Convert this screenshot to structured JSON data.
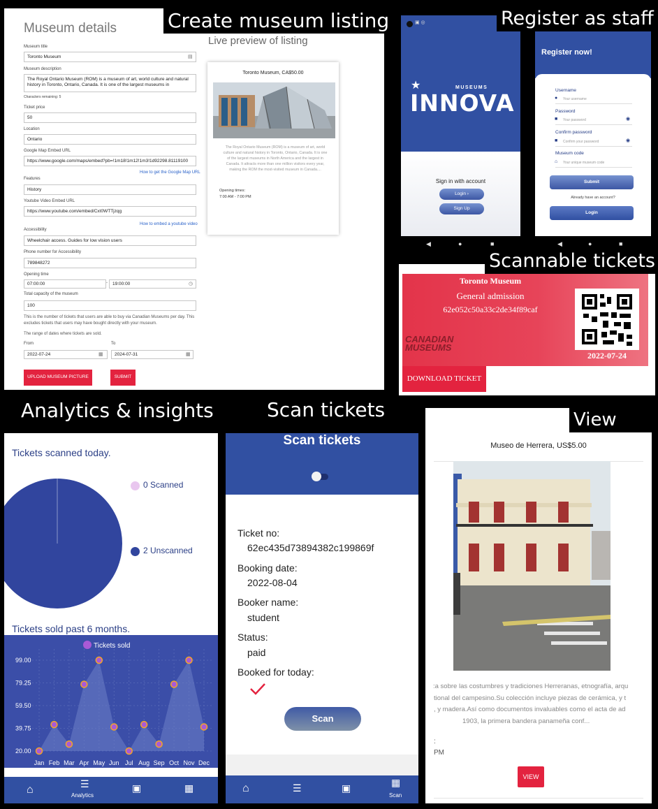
{
  "captions": {
    "create": "Create museum listing",
    "register": "Register as staff",
    "scannable": "Scannable tickets",
    "analytics": "Analytics & insights",
    "scan": "Scan tickets",
    "view": "View"
  },
  "form": {
    "title": "Museum details",
    "museum_title_label": "Museum title",
    "museum_title_value": "Toronto Museum",
    "description_label": "Museum description",
    "description_value": "The Royal Ontario Museum (ROM) is a museum of art, world culture and natural history in Toronto, Ontario, Canada. It is one of the largest museums in",
    "chars_remaining": "Characters remaining: 5",
    "ticket_price_label": "Ticket price",
    "ticket_price_value": "50",
    "location_label": "Location",
    "location_value": "Ontario",
    "map_label": "Google Map Embed URL",
    "map_value": "https://www.google.com/maps/embed?pb=!1m18!1m12!1m3!1d92298.81119100",
    "map_help": "How to get the Google Map URL",
    "features_label": "Features",
    "features_value": "History",
    "youtube_label": "Youtube Video Embed URL",
    "youtube_value": "https://www.youtube.com/embed/Cxt0WTTjzqg",
    "youtube_help": "How to embed a youtube video",
    "access_label": "Accessibility",
    "access_value": "Wheelchair access. Guides for low vision users",
    "phone_label": "Phone number for Accessibility",
    "phone_value": "789848272",
    "opening_label": "Opening time",
    "open_from": "07:00:00",
    "open_to": "19:00:00",
    "capacity_label": "Total capacity of the museum",
    "capacity_value": "100",
    "capacity_note": "This is the number of tickets that users are able to buy via Canadian Museums per day. This excludes tickets that users may have bought directly with your museum.",
    "range_note": "The range of dates where tickets are sold.",
    "from_label": "From",
    "to_label": "To",
    "from_value": "2022-07-24",
    "to_value": "2024-07-31",
    "upload_btn": "UPLOAD MUSEUM PICTURE",
    "submit_btn": "SUBMIT"
  },
  "preview": {
    "heading": "Live preview of listing",
    "card_title": "Toronto Museum, CA$50.00",
    "card_desc": "The Royal Ontario Museum (ROM) is a museum of art, world culture and natural history in Toronto, Ontario, Canada. It is one of the largest museums in North America and the largest in Canada. It attracts more than one million visitors every year, making the ROM the most-visited museum in Canada....",
    "hours_label": "Opening times:",
    "hours_value": "7:00 AM - 7:00 PM"
  },
  "splash": {
    "brand_small": "MUSEUMS",
    "brand": "INNOVA",
    "sign_in": "Sign in with account",
    "login_btn": "Login ›",
    "signup_btn": "Sign Up"
  },
  "register": {
    "title": "Register now!",
    "username_label": "Username",
    "username_ph": "Your username",
    "password_label": "Password",
    "password_ph": "Your password",
    "confirm_label": "Confirm password",
    "confirm_ph": "Confirm your password",
    "code_label": "Museum code",
    "code_ph": "Your unique museum code",
    "submit_btn": "Submit",
    "already": "Already have an account?",
    "login_btn": "Login"
  },
  "ticket": {
    "museum": "Toronto Museum",
    "type": "General admission",
    "id": "62e052c50a33c2de34f89caf",
    "date": "2022-07-24",
    "logo_text": "CANADIAN MUSEUMS",
    "download_btn": "DOWNLOAD TICKET"
  },
  "analytics": {
    "scanned_title": "Tickets scanned today.",
    "scanned_legend": "0 Scanned",
    "unscanned_legend": "2 Unscanned",
    "sold_title": "Tickets sold past 6 months.",
    "series_name": "Tickets sold",
    "nav_active": "Analytics"
  },
  "chart_data": [
    {
      "type": "pie",
      "title": "Tickets scanned today.",
      "categories": [
        "Scanned",
        "Unscanned"
      ],
      "values": [
        0,
        2
      ],
      "colors": [
        "#e9c7ef",
        "#31459e"
      ]
    },
    {
      "type": "line",
      "title": "Tickets sold past 6 months.",
      "categories": [
        "Jan",
        "Feb",
        "Mar",
        "Apr",
        "May",
        "Jun",
        "Jul",
        "Aug",
        "Sep",
        "Oct",
        "Nov",
        "Dec"
      ],
      "series": [
        {
          "name": "Tickets sold",
          "values": [
            20,
            43,
            26,
            78,
            99,
            41,
            20,
            43,
            26,
            78,
            99,
            41
          ]
        }
      ],
      "y_ticks": [
        "99.00",
        "79.25",
        "59.50",
        "39.75",
        "20.00"
      ],
      "ylim": [
        20,
        99
      ],
      "grid": true,
      "legend": "top-center"
    }
  ],
  "scan": {
    "title": "Scan tickets",
    "ticket_no_label": "Ticket no:",
    "ticket_no": "62ec435d73894382c199869f",
    "booking_date_label": "Booking date:",
    "booking_date": "2022-08-04",
    "booker_label": "Booker name:",
    "booker": "student",
    "status_label": "Status:",
    "status": "paid",
    "today_label": "Booked for today:",
    "scan_btn": "Scan",
    "nav_active": "Scan"
  },
  "view": {
    "title": "Museo de Herrera, US$5.00",
    "desc1": ":a sobre las costumbres y tradiciones Herreranas, etnografía, arqu",
    "desc2": "tional del campesino.Su colección incluye piezas de cerámica, y t",
    "desc3": ", y madera.Así como documentos invaluables como el acta de ad",
    "desc4": "1903, la primera bandera panameña conf...",
    "hours_colon": ":",
    "hours_pm": "PM",
    "view_btn": "VIEW"
  }
}
